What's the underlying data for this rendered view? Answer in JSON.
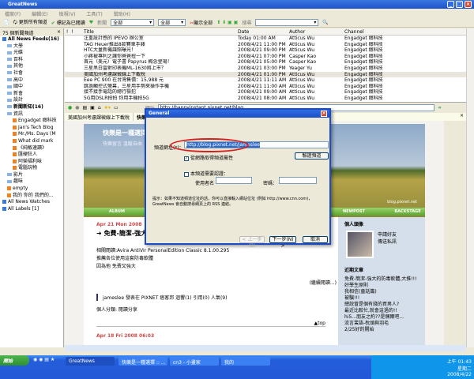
{
  "window": {
    "title": "GreatNews"
  },
  "menu": [
    "檔案(F)",
    "編輯(E)",
    "檢視(V)",
    "工具(T)",
    "幫助(H)"
  ],
  "toolbar": {
    "update_all": "更新所有頻道",
    "mark_read": "標記為已閱讀",
    "filter_label": "新聞",
    "filter1": "全部",
    "filter2": "全部",
    "show_all": "顯示全部",
    "search_label": "搜尋",
    "search_value": ""
  },
  "sidebar": {
    "header": "75 個新聞頻道",
    "close": "×",
    "items": [
      {
        "label": "All News Feeds(16)",
        "type": "root",
        "bold": true
      },
      {
        "label": "大學",
        "type": "folder"
      },
      {
        "label": "光碟",
        "type": "folder"
      },
      {
        "label": "百科",
        "type": "folder"
      },
      {
        "label": "其他",
        "type": "folder"
      },
      {
        "label": "社會",
        "type": "folder"
      },
      {
        "label": "高中",
        "type": "folder"
      },
      {
        "label": "國中",
        "type": "folder"
      },
      {
        "label": "新會",
        "type": "folder"
      },
      {
        "label": "設計",
        "type": "folder"
      },
      {
        "label": "新聞新知(16)",
        "type": "folder",
        "bold": true
      },
      {
        "label": "資訊",
        "type": "folder"
      },
      {
        "label": "Engadget 癮科技",
        "type": "feed",
        "indent": true
      },
      {
        "label": "Jan's Tech Blog",
        "type": "feed",
        "indent": true
      },
      {
        "label": "Mr./Ms. Days (M",
        "type": "feed",
        "indent": true
      },
      {
        "label": "What did mark",
        "type": "feed",
        "indent": true
      },
      {
        "label": "《純敏速讀》",
        "type": "feed",
        "indent": true
      },
      {
        "label": "匯硬狂人",
        "type": "feed",
        "indent": true
      },
      {
        "label": "阿榮福利味",
        "type": "feed",
        "indent": true
      },
      {
        "label": "電腦玩物",
        "type": "feed",
        "indent": true
      },
      {
        "label": "影片",
        "type": "folder"
      },
      {
        "label": "趣味",
        "type": "folder"
      },
      {
        "label": "empty",
        "type": "feed"
      },
      {
        "label": "我的 你的 我們的...",
        "type": "feed"
      },
      {
        "label": "All News Watches",
        "type": "root"
      },
      {
        "label": "All Labels [1]",
        "type": "root"
      }
    ]
  },
  "list": {
    "columns": [
      "Title",
      "Date",
      "Author",
      "Channel"
    ],
    "rows": [
      {
        "title": "注重設計感的 IPEVO 辦公室",
        "date": "Today 01:00 AM",
        "author": "Atticus Wu",
        "channel": "Engadget 癮科技"
      },
      {
        "title": "TAG Heuer推出8款賽車手錶",
        "date": "2008/4/21 11:00 PM",
        "author": "Atticus Wu",
        "channel": "Engadget 癮科技"
      },
      {
        "title": "HTC大量新機諜照曝光！",
        "date": "2008/4/21 09:00 PM",
        "author": "Atticus Wu",
        "channel": "Engadget 癮科技"
      },
      {
        "title": "小蔣被專利之讓你爸爸扭一下",
        "date": "2008/4/21 07:00 PM",
        "author": "Casper Kao",
        "channel": "Engadget 癮科技"
      },
      {
        "title": "首元（美元）電子書 Papyrus 概念登場！",
        "date": "2008/4/21 05:00 PM",
        "author": "Casper Kao",
        "channel": "Engadget 癮科技"
      },
      {
        "title": "三星黑白雷射印表機ML-1630將上市？",
        "date": "2008/4/21 03:00 PM",
        "author": "Yeager Yu",
        "channel": "Engadget 癮科技"
      },
      {
        "title": "美國加州考慮課徵線上下載稅",
        "date": "2008/4/21 01:00 PM",
        "author": "Atticus Wu",
        "channel": "Engadget 癮科技",
        "selected": true
      },
      {
        "title": "Eee PC 900 在台灣售價：15,988 元",
        "date": "2008/4/21 11:11 AM",
        "author": "Atticus Wu",
        "channel": "Engadget 癮科技"
      },
      {
        "title": "跳過觸控式螢幕，三星用手勢來操作手機",
        "date": "2008/4/21 11:00 AM",
        "author": "Atticus Wu",
        "channel": "Engadget 癮科技"
      },
      {
        "title": "接不接手電話的總行檢犯",
        "date": "2008/4/21 09:00 AM",
        "author": "Atticus Wu",
        "channel": "Engadget 癮科技"
      },
      {
        "title": "5G用DSLR拍拍 你用手機拍5G",
        "date": "2008/4/21 08:00 AM",
        "author": "Atticus Wu",
        "channel": "Engadget 癮科技"
      }
    ]
  },
  "browser": {
    "address_label": "網址",
    "address": "http://happyinstant.pixnet.net/blog",
    "tabs": [
      "美國加州考慮課徵線上下載稅",
      "快樂是一種選擇"
    ]
  },
  "web": {
    "blog_title": "快樂是一種選擇",
    "blog_subtitle": "快樂留言 溫暖自由",
    "nav": [
      "ALBUM",
      "NEWPOST",
      "BACKSTAGE"
    ],
    "watermark": "blog.pixnet.net",
    "post1": {
      "date": "Apr 21 Mon 2008",
      "title": "免費-簡潔-強大",
      "lines": [
        "相關閱讀:Avira AntiVir PersonalEdition Classic 8.1.00.295",
        "推薦各位使用這套防毒軟體",
        "因為他 免費又強大"
      ],
      "more": "(繼續閱讀...)",
      "meta": "jameslee 發表在 PIXNET 痞客邦 迴響(1) 引用(0) 人氣(9)",
      "category": "個人分類: 閱讀分享",
      "top": "▲top"
    },
    "post2": {
      "date": "Apr 18 Fri 2008 06:03"
    },
    "side": {
      "avatar_title": "個人頭像",
      "avatar_links": [
        "申請好友",
        "傳送私訊"
      ],
      "recent_title": "近期文章",
      "recent": [
        "免費-簡潔-強大的防毒軟體,大推!!!",
        "好學生原則",
        "我相信(童話篇)",
        "被騙!!!",
        "總說冒是個有錢的買男人?",
        "最近比較忙,就會這過的!!",
        "hi5...朋友之約??是偶爾吧...",
        "流言蜚語-枕頭與羽毛",
        "2/25好的開始"
      ]
    }
  },
  "dialog": {
    "title": "General",
    "url_label": "頻道網址(*)：",
    "url_value": "http://blog.pixnet.net/jameslee",
    "auto_label": "從網路取得頻道屬性",
    "auto_checked": true,
    "verify_button": "驗證頻道",
    "auth_label": "本頻道需要認證：",
    "auth_checked": false,
    "user_label": "使用者名",
    "pass_label": "密碼：",
    "hint": "提示：如果不知道頻道位址的話，你可以直接輸入網站位址 (例如 http://www.cnn.com)，GreatNews 會自動搜尋網頁上的 RSS 連結。",
    "back": "< 上一步(B)",
    "next": "下一步(N) >",
    "cancel": "取消"
  },
  "taskbar": {
    "start": "開始",
    "tasks": [
      "GreatNews",
      "快樂是一種選擇 :: ...",
      "cn3 - 小畫家",
      "我的"
    ],
    "time": "上午 01:43",
    "weekday": "星期二",
    "date": "2008/4/22"
  },
  "colors": {
    "titlebar": "#1d52c9",
    "annotation": "#d42020",
    "date_red": "#d04848"
  }
}
